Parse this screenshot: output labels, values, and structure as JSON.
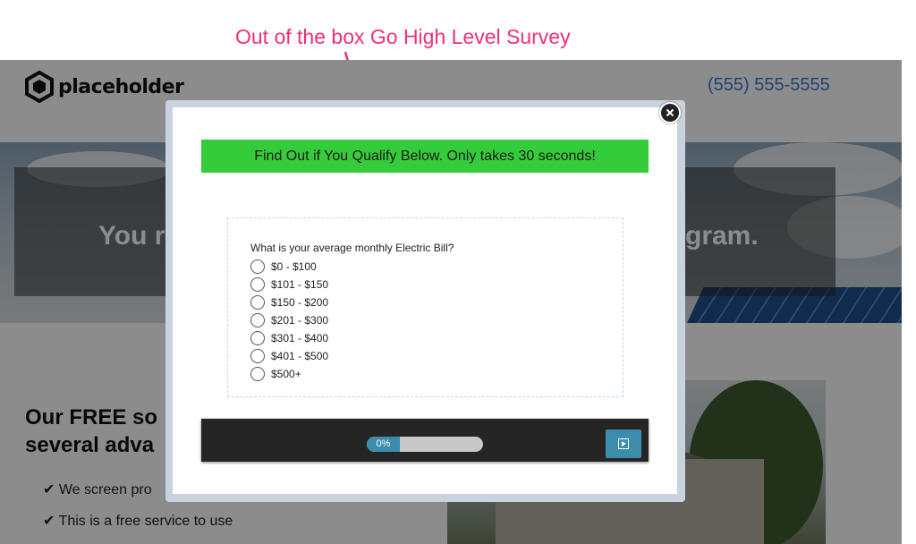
{
  "annotation": {
    "text": "Out of the box Go High Level Survey",
    "color": "#ef2f7a"
  },
  "site": {
    "logo_text": "placeholder",
    "phone": "(555) 555-5555",
    "hero_left": "You r",
    "hero_right": "gram.",
    "heading_line1": "Our FREE so",
    "heading_line2": "several adva",
    "checklist": [
      "✔ We screen pro",
      "✔ This is a free service to use"
    ]
  },
  "modal": {
    "banner": "Find Out if You Qualify Below. Only takes 30 seconds!",
    "banner_color": "#34cc3a",
    "question": "What is your average monthly Electric Bill?",
    "options": [
      "$0 - $100",
      "$101 - $150",
      "$150 - $200",
      "$201 - $300",
      "$301 - $400",
      "$401 - $500",
      "$500+"
    ],
    "progress": {
      "label": "0%",
      "value": 0
    },
    "accent_color": "#3c8dad",
    "icons": {
      "close": "close-icon",
      "next": "next-arrow-icon"
    }
  }
}
